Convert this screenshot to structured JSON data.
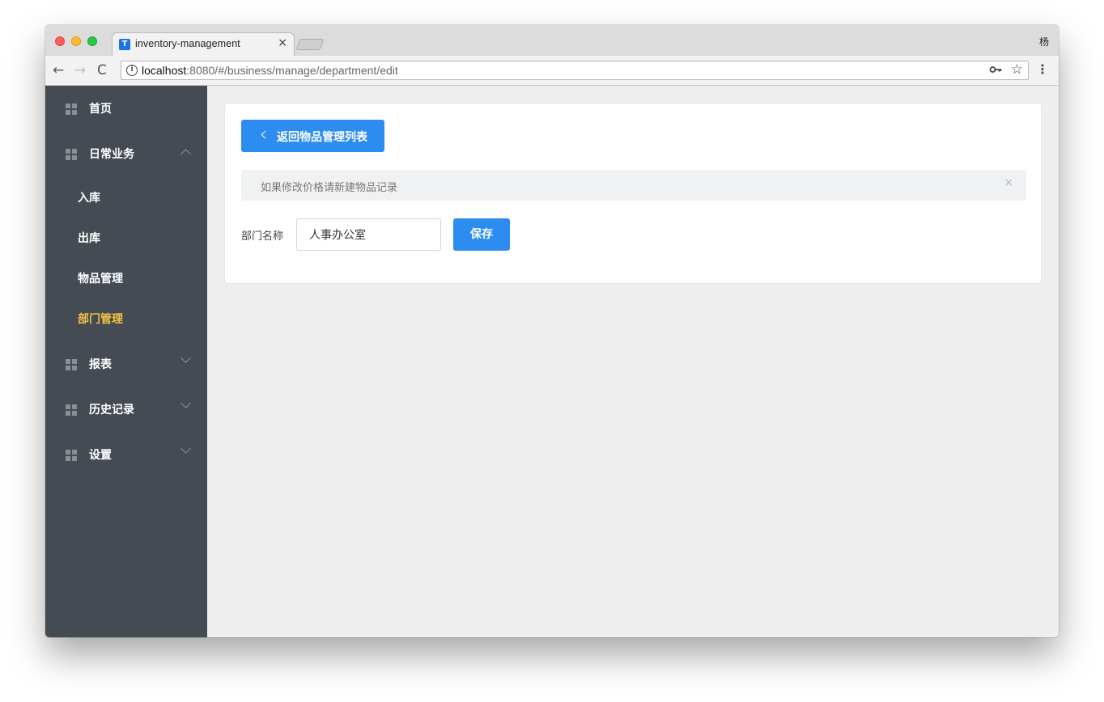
{
  "browser": {
    "tab_title": "inventory-management",
    "tab_favicon_letter": "T",
    "tab_close": "×",
    "profile": "杨",
    "url_host": "localhost",
    "url_rest": ":8080/#/business/manage/department/edit",
    "back": "←",
    "forward": "→",
    "reload": "C",
    "info": "i",
    "key": "🔑",
    "star": "☆",
    "menu": "⋮"
  },
  "sidebar": {
    "groups": [
      {
        "label": "首页",
        "icon": "grid-icon",
        "chevron": "none"
      },
      {
        "label": "日常业务",
        "icon": "grid-icon",
        "chevron": "up"
      },
      {
        "label": "报表",
        "icon": "grid-icon",
        "chevron": "down"
      },
      {
        "label": "历史记录",
        "icon": "grid-icon",
        "chevron": "down"
      },
      {
        "label": "设置",
        "icon": "grid-icon",
        "chevron": "down"
      }
    ],
    "sub_items": [
      {
        "label": "入库",
        "active": false
      },
      {
        "label": "出库",
        "active": false
      },
      {
        "label": "物品管理",
        "active": false
      },
      {
        "label": "部门管理",
        "active": true
      }
    ]
  },
  "main": {
    "back_button": "返回物品管理列表",
    "alert_text": "如果修改价格请新建物品记录",
    "alert_close": "×",
    "form": {
      "label": "部门名称",
      "value": "人事办公室"
    },
    "save_button": "保存"
  },
  "colors": {
    "primary": "#2d8cf0",
    "sidebar_bg": "#454b53",
    "active_menu": "#f5c342"
  }
}
